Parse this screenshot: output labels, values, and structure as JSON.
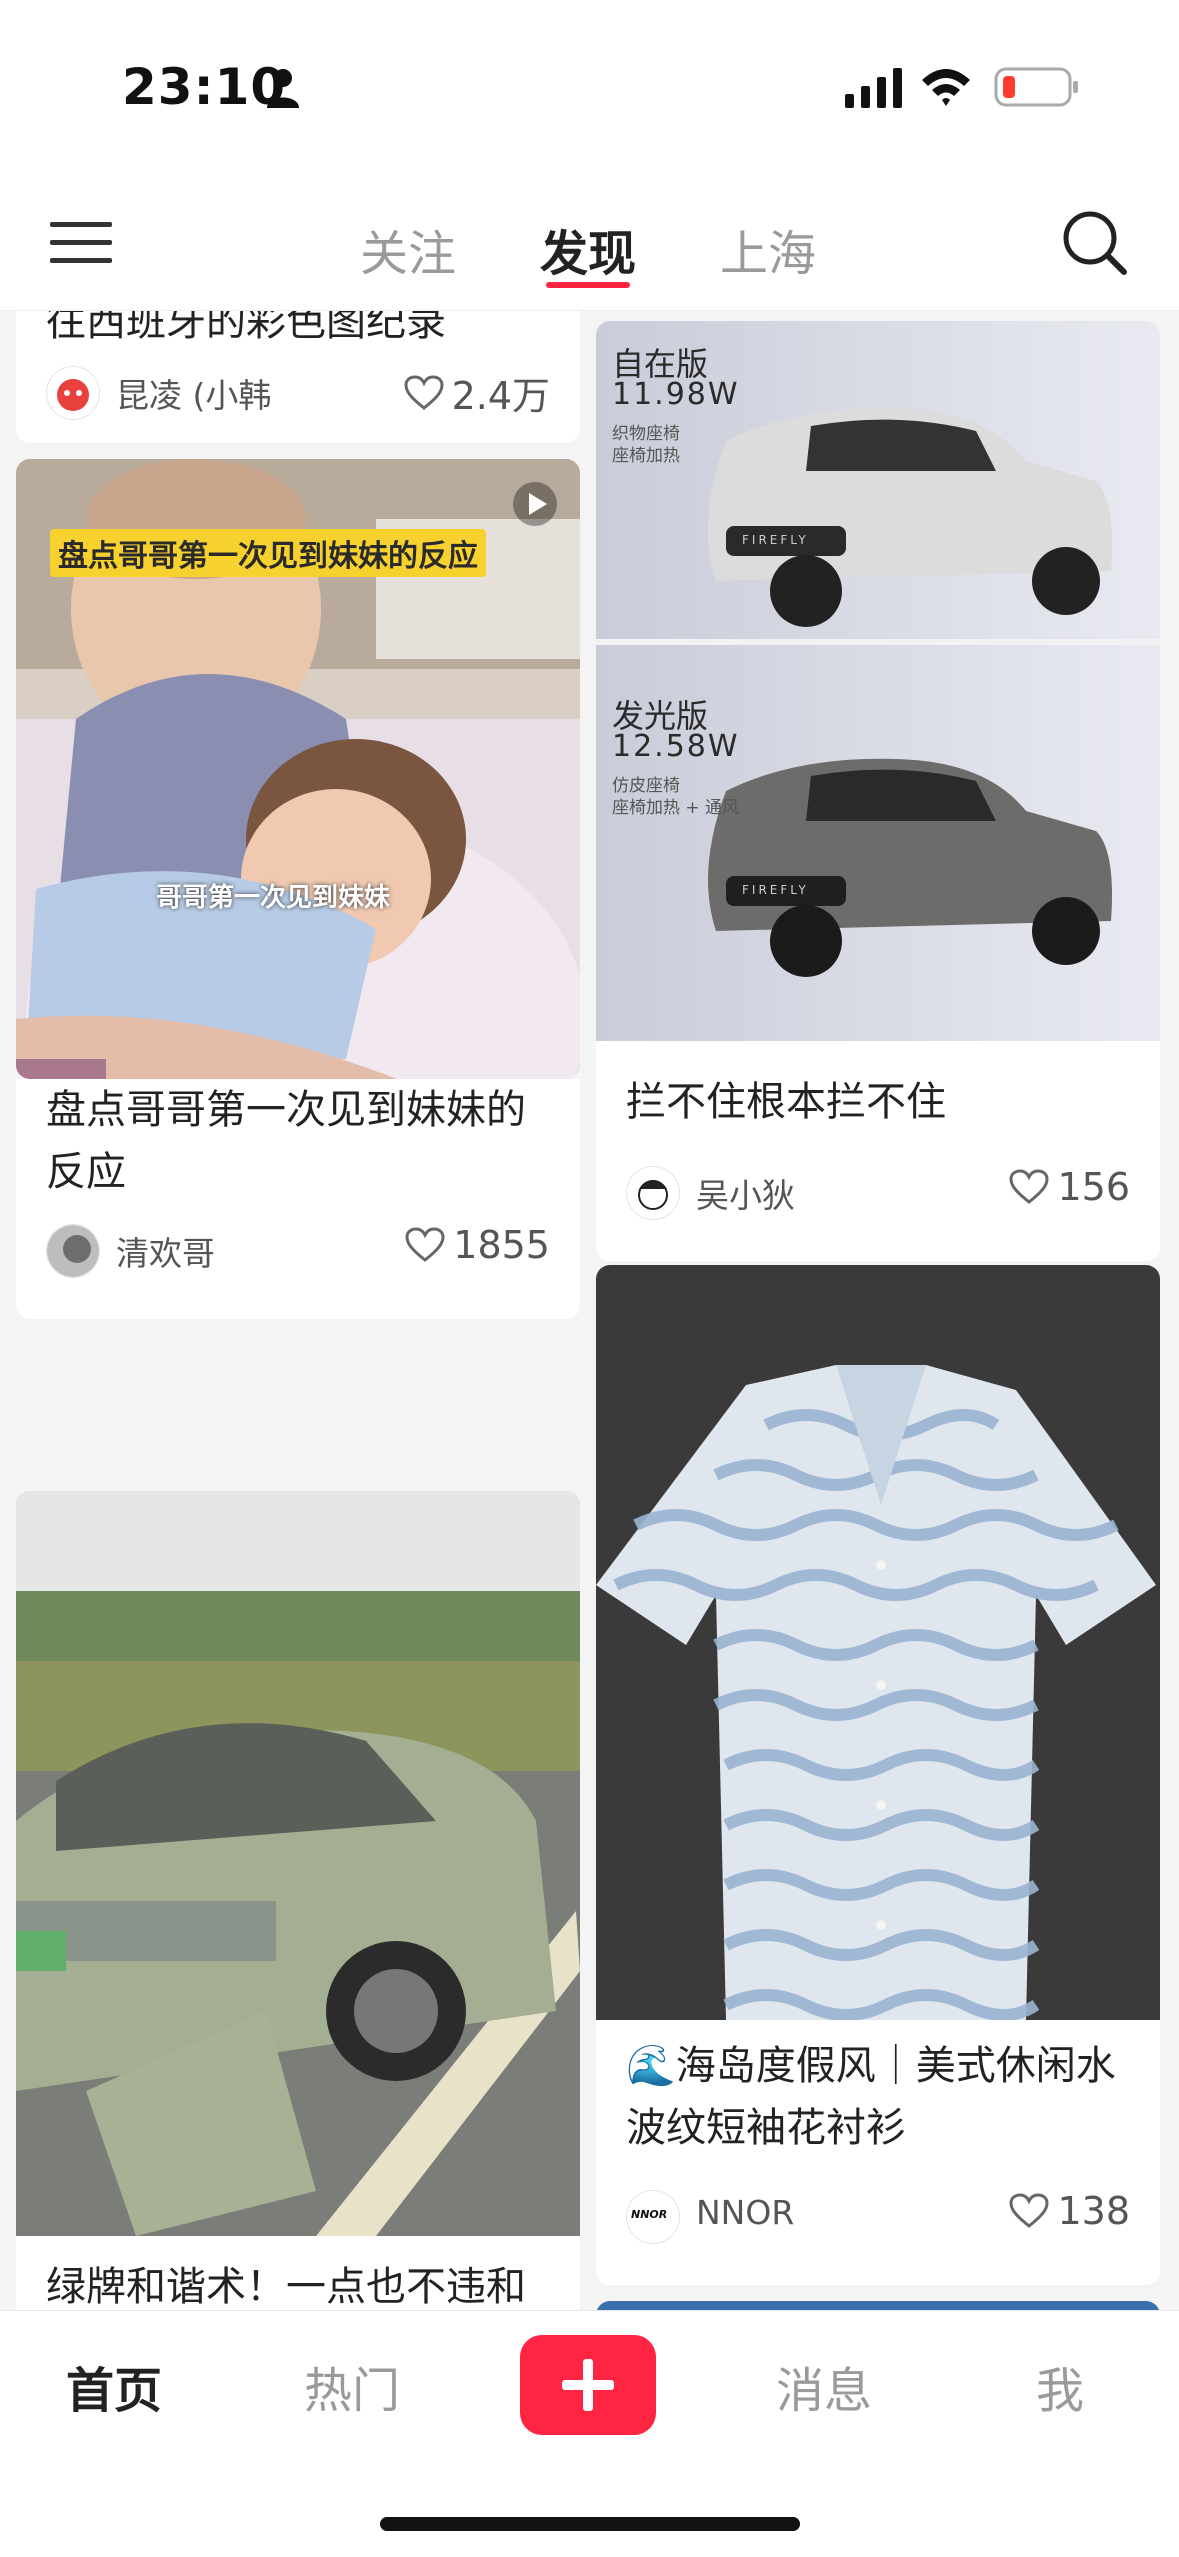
{
  "status_bar": {
    "time": "23:10"
  },
  "top_nav": {
    "tabs": [
      {
        "label": "关注",
        "active": false
      },
      {
        "label": "发现",
        "active": true
      },
      {
        "label": "上海",
        "active": false
      }
    ]
  },
  "feed": {
    "left": [
      {
        "title": "往西班牙的彩色图纪录",
        "author": "昆凌 (小韩",
        "likes": "2.4万"
      },
      {
        "title": "盘点哥哥第一次见到妹妹的反应",
        "author": "清欢哥",
        "likes": "1855",
        "image_caption_top": "盘点哥哥第一次见到妹妹的反应",
        "image_caption_mid": "哥哥第一次见到妹妹"
      },
      {
        "title": "绿牌和谐术！一点也不违和"
      }
    ],
    "right": [
      {
        "title": "拦不住根本拦不住",
        "author": "吴小狄",
        "likes": "156",
        "image_text": {
          "v1_name": "自在版",
          "v1_price": "11.98W",
          "v1_f1": "织物座椅",
          "v1_f2": "座椅加热",
          "v2_name": "发光版",
          "v2_price": "12.58W",
          "v2_f1": "仿皮座椅",
          "v2_f2": "座椅加热 + 通风",
          "plate": "FIREFLY"
        }
      },
      {
        "title": "🌊海岛度假风｜美式休闲水波纹短袖花衬衫",
        "author": "NNOR",
        "likes": "138",
        "avatar_text": "NNOR"
      }
    ]
  },
  "bottom_nav": {
    "items": [
      {
        "label": "首页",
        "active": true
      },
      {
        "label": "热门",
        "active": false
      },
      {
        "label": "消息",
        "active": false
      },
      {
        "label": "我",
        "active": false
      }
    ]
  },
  "colors": {
    "accent": "#ff2442",
    "text": "#222222",
    "muted": "#9a9a9a"
  },
  "icons": [
    "person-icon",
    "signal-icon",
    "wifi-icon",
    "battery-icon",
    "menu-icon",
    "search-icon",
    "heart-icon",
    "play-icon",
    "plus-icon"
  ]
}
